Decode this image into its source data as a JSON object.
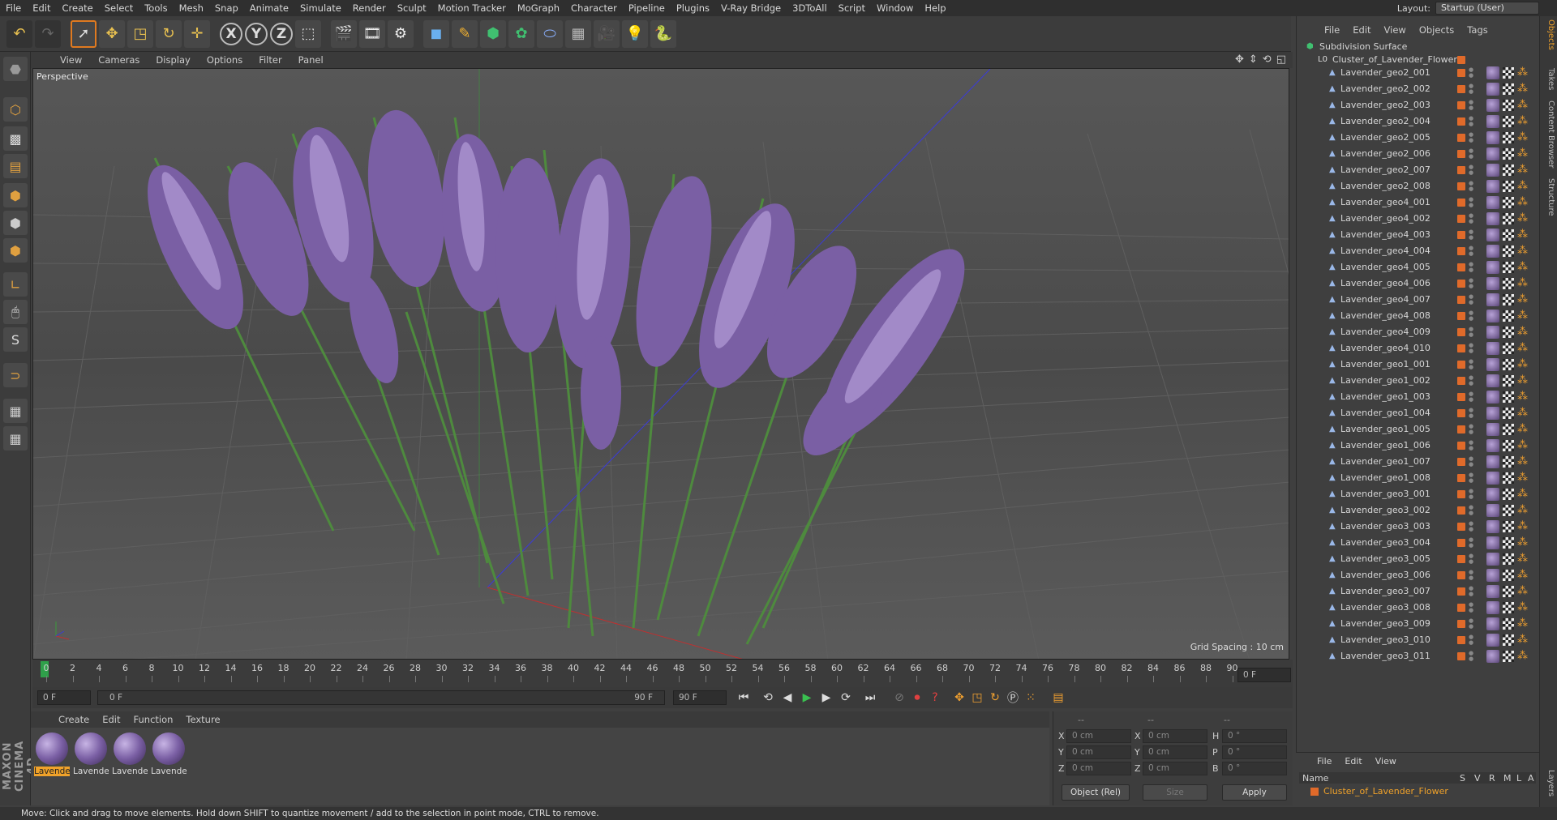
{
  "menubar": {
    "items": [
      "File",
      "Edit",
      "Create",
      "Select",
      "Tools",
      "Mesh",
      "Snap",
      "Animate",
      "Simulate",
      "Render",
      "Sculpt",
      "Motion Tracker",
      "MoGraph",
      "Character",
      "Pipeline",
      "Plugins",
      "V-Ray Bridge",
      "3DToAll",
      "Script",
      "Window",
      "Help"
    ],
    "layout_label": "Layout:",
    "layout_value": "Startup (User)"
  },
  "viewport": {
    "menu": [
      "View",
      "Cameras",
      "Display",
      "Options",
      "Filter",
      "Panel"
    ],
    "label": "Perspective",
    "grid_spacing": "Grid Spacing : 10 cm"
  },
  "timeline": {
    "ticks": [
      "0",
      "2",
      "4",
      "6",
      "8",
      "10",
      "12",
      "14",
      "16",
      "18",
      "20",
      "22",
      "24",
      "26",
      "28",
      "30",
      "32",
      "34",
      "36",
      "38",
      "40",
      "42",
      "44",
      "46",
      "48",
      "50",
      "52",
      "54",
      "56",
      "58",
      "60",
      "62",
      "64",
      "66",
      "68",
      "70",
      "72",
      "74",
      "76",
      "78",
      "80",
      "82",
      "84",
      "86",
      "88",
      "90"
    ],
    "current_frame_right": "0 F"
  },
  "transport": {
    "start_field": "0 F",
    "range_start": "0 F",
    "range_end": "90 F",
    "end_field": "90 F"
  },
  "material_manager": {
    "menu": [
      "Create",
      "Edit",
      "Function",
      "Texture"
    ],
    "materials": [
      "Lavende",
      "Lavende",
      "Lavende",
      "Lavende"
    ]
  },
  "coordinates": {
    "header": [
      "--",
      "--",
      "--"
    ],
    "rows": [
      {
        "a": "X",
        "av": "0 cm",
        "b": "X",
        "bv": "0 cm",
        "c": "H",
        "cv": "0 °"
      },
      {
        "a": "Y",
        "av": "0 cm",
        "b": "Y",
        "bv": "0 cm",
        "c": "P",
        "cv": "0 °"
      },
      {
        "a": "Z",
        "av": "0 cm",
        "b": "Z",
        "bv": "0 cm",
        "c": "B",
        "cv": "0 °"
      }
    ],
    "mode": "Object (Rel)",
    "size": "Size",
    "apply": "Apply"
  },
  "status_text": "Move: Click and drag to move elements. Hold down SHIFT to quantize movement / add to the selection in point mode, CTRL to remove.",
  "object_manager": {
    "menu": [
      "File",
      "Edit",
      "View",
      "Objects",
      "Tags"
    ],
    "root": "Subdivision Surface",
    "cluster": "Cluster_of_Lavender_Flower",
    "objects": [
      "Lavender_geo2_001",
      "Lavender_geo2_002",
      "Lavender_geo2_003",
      "Lavender_geo2_004",
      "Lavender_geo2_005",
      "Lavender_geo2_006",
      "Lavender_geo2_007",
      "Lavender_geo2_008",
      "Lavender_geo4_001",
      "Lavender_geo4_002",
      "Lavender_geo4_003",
      "Lavender_geo4_004",
      "Lavender_geo4_005",
      "Lavender_geo4_006",
      "Lavender_geo4_007",
      "Lavender_geo4_008",
      "Lavender_geo4_009",
      "Lavender_geo4_010",
      "Lavender_geo1_001",
      "Lavender_geo1_002",
      "Lavender_geo1_003",
      "Lavender_geo1_004",
      "Lavender_geo1_005",
      "Lavender_geo1_006",
      "Lavender_geo1_007",
      "Lavender_geo1_008",
      "Lavender_geo3_001",
      "Lavender_geo3_002",
      "Lavender_geo3_003",
      "Lavender_geo3_004",
      "Lavender_geo3_005",
      "Lavender_geo3_006",
      "Lavender_geo3_007",
      "Lavender_geo3_008",
      "Lavender_geo3_009",
      "Lavender_geo3_010",
      "Lavender_geo3_011"
    ]
  },
  "layer_manager": {
    "menu": [
      "File",
      "Edit",
      "View"
    ],
    "columns": [
      "Name",
      "S",
      "V",
      "R",
      "M",
      "L",
      "A"
    ],
    "layer": "Cluster_of_Lavender_Flower"
  },
  "side_tabs": [
    "Objects",
    "Takes",
    "Content Browser",
    "Structure",
    "Layers"
  ],
  "logo": "MAXON CINEMA 4D",
  "colors": {
    "accent_orange": "#f0a22a",
    "layer_color": "#e06a2a",
    "playhead": "#2fa04a",
    "flower": "#7a5fa4"
  }
}
